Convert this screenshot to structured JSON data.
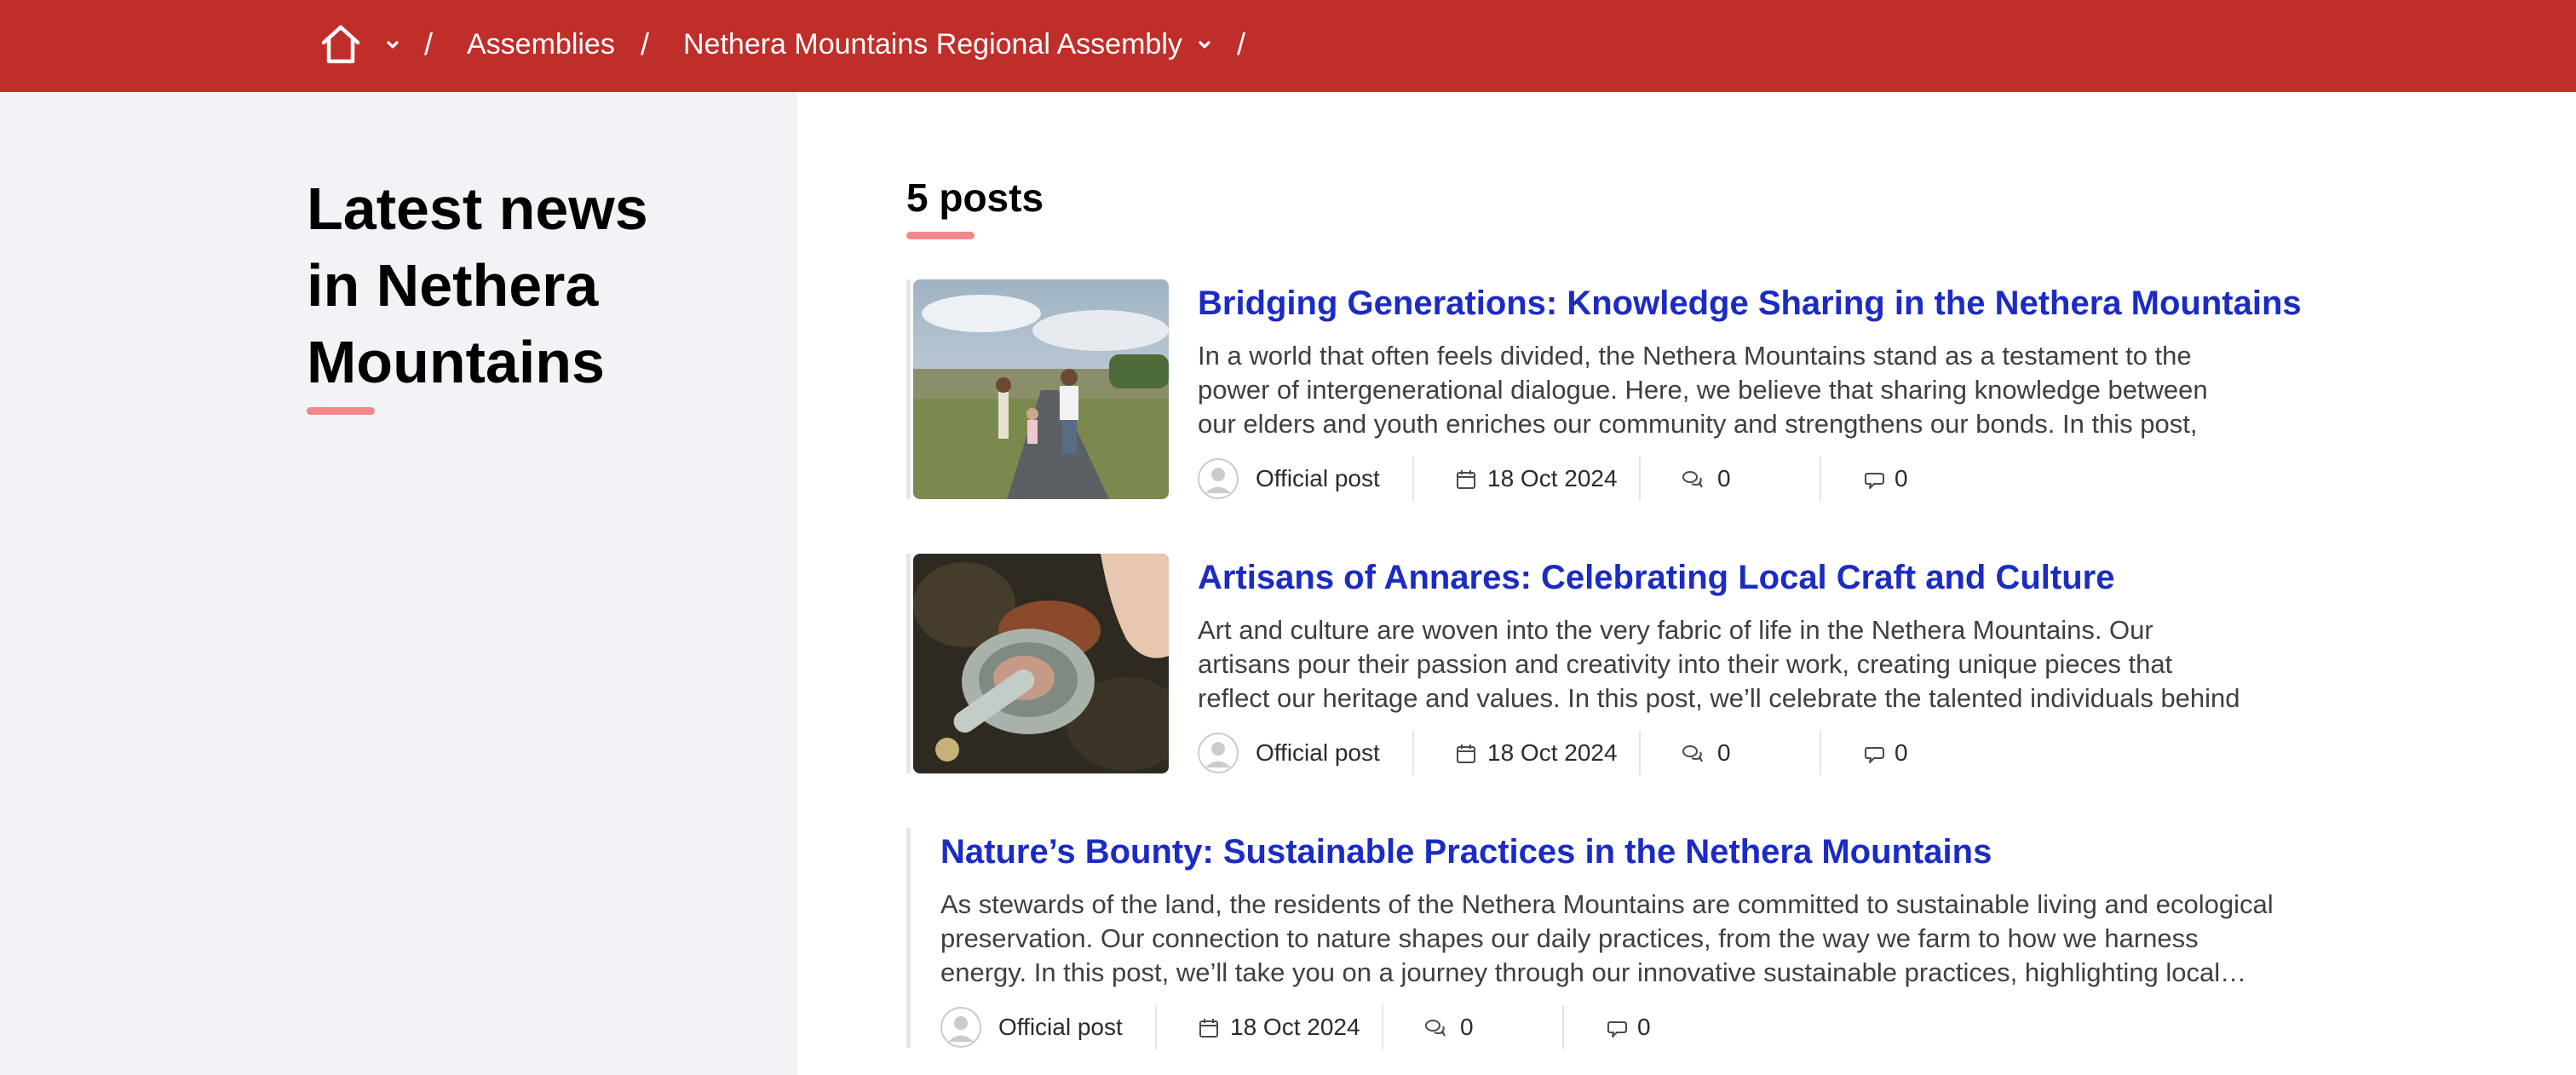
{
  "breadcrumb": {
    "home_icon": "home-icon",
    "chevron_icon": "chevron-down-icon",
    "separator": "/",
    "assemblies": "Assemblies",
    "assembly": "Nethera Mountains Regional Assembly"
  },
  "sidebar": {
    "title_lines": [
      "Latest news",
      "in Nethera",
      "Mountains"
    ]
  },
  "posts": {
    "count_label": "5 posts",
    "items": [
      {
        "title": "Bridging Generations: Knowledge Sharing in the Nethera Mountains",
        "body": "In a world that often feels divided, the Nethera Mountains stand as a testament to the power of intergenerational dialogue. Here, we believe that sharing knowledge between our elders and youth enriches our community and strengthens our bonds. In this post, we’ll explore t…",
        "author": "Official post",
        "date": "18 Oct 2024",
        "comments": "0",
        "endorsements": "0"
      },
      {
        "title": "Artisans of Annares: Celebrating Local Craft and Culture",
        "body": "Art and culture are woven into the very fabric of life in the Nethera Mountains. Our artisans pour their passion and creativity into their work, creating unique pieces that reflect our heritage and values. In this post, we’ll celebrate the talented individuals behind our local…",
        "author": "Official post",
        "date": "18 Oct 2024",
        "comments": "0",
        "endorsements": "0"
      },
      {
        "title": "Nature’s Bounty: Sustainable Practices in the Nethera Mountains",
        "body": "As stewards of the land, the residents of the Nethera Mountains are committed to sustainable living and ecological preservation. Our connection to nature shapes our daily practices, from the way we farm to how we harness energy. In this post, we’ll take you on a journey through our innovative sustainable practices, highlighting local…",
        "author": "Official post",
        "date": "18 Oct 2024",
        "comments": "0",
        "endorsements": "0"
      }
    ]
  },
  "colors": {
    "header_bg": "#c02e2a",
    "accent_underline": "#f2888b",
    "link_title": "#1b2bc4",
    "sidebar_bg": "#f2f3f6"
  }
}
